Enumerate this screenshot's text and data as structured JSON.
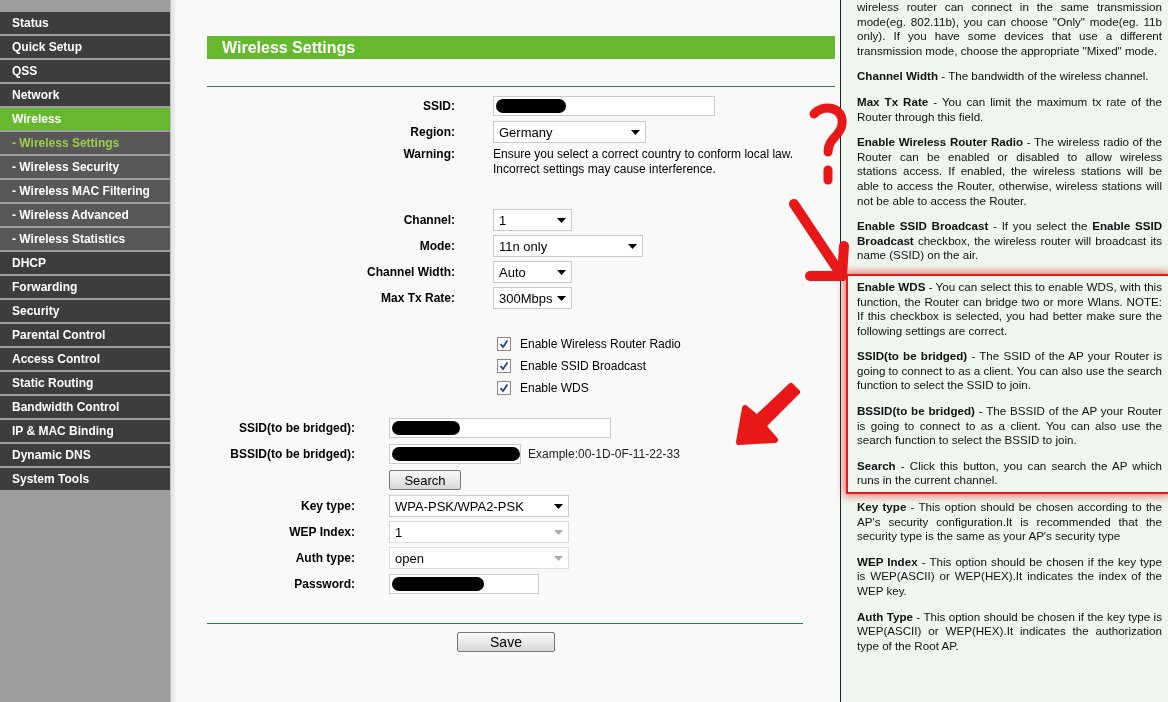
{
  "sidebar": {
    "items": [
      {
        "label": "Status",
        "expanded": false
      },
      {
        "label": "Quick Setup",
        "expanded": false
      },
      {
        "label": "QSS",
        "expanded": false
      },
      {
        "label": "Network",
        "expanded": false
      },
      {
        "label": "Wireless",
        "expanded": true,
        "children": [
          {
            "label": "- Wireless Settings",
            "selected": true
          },
          {
            "label": "- Wireless Security",
            "selected": false
          },
          {
            "label": "- Wireless MAC Filtering",
            "selected": false
          },
          {
            "label": "- Wireless Advanced",
            "selected": false
          },
          {
            "label": "- Wireless Statistics",
            "selected": false
          }
        ]
      },
      {
        "label": "DHCP",
        "expanded": false
      },
      {
        "label": "Forwarding",
        "expanded": false
      },
      {
        "label": "Security",
        "expanded": false
      },
      {
        "label": "Parental Control",
        "expanded": false
      },
      {
        "label": "Access Control",
        "expanded": false
      },
      {
        "label": "Static Routing",
        "expanded": false
      },
      {
        "label": "Bandwidth Control",
        "expanded": false
      },
      {
        "label": "IP & MAC Binding",
        "expanded": false
      },
      {
        "label": "Dynamic DNS",
        "expanded": false
      },
      {
        "label": "System Tools",
        "expanded": false
      }
    ]
  },
  "form": {
    "title": "Wireless Settings",
    "basic": [
      {
        "kind": "redacted-input",
        "label": "SSID:"
      },
      {
        "kind": "select",
        "label": "Region:",
        "value": "Germany",
        "disabled": false
      },
      {
        "kind": "note",
        "label": "Warning:",
        "lines": [
          "Ensure you select a correct country to conform local law.",
          "Incorrect settings may cause interference."
        ]
      }
    ],
    "radio": [
      {
        "kind": "select",
        "label": "Channel:",
        "value": "1",
        "disabled": false
      },
      {
        "kind": "select",
        "label": "Mode:",
        "value": "11n only",
        "disabled": false
      },
      {
        "kind": "select",
        "label": "Channel Width:",
        "value": "Auto",
        "disabled": false
      },
      {
        "kind": "select",
        "label": "Max Tx Rate:",
        "value": "300Mbps",
        "disabled": false
      }
    ],
    "options": [
      {
        "label": "Enable Wireless Router Radio",
        "checked": true
      },
      {
        "label": "Enable SSID Broadcast",
        "checked": true
      },
      {
        "label": "Enable WDS",
        "checked": true
      }
    ],
    "wds": [
      {
        "kind": "redacted-input",
        "label": "SSID(to be bridged):"
      },
      {
        "kind": "redacted-input",
        "label": "BSSID(to be bridged):",
        "hint": "Example:00-1D-0F-11-22-33"
      },
      {
        "kind": "button",
        "text": "Search"
      },
      {
        "kind": "select",
        "label": "Key type:",
        "value": "WPA-PSK/WPA2-PSK",
        "disabled": false
      },
      {
        "kind": "select",
        "label": "WEP Index:",
        "value": "1",
        "disabled": true
      },
      {
        "kind": "select",
        "label": "Auth type:",
        "value": "open",
        "disabled": true
      },
      {
        "kind": "redacted-input",
        "label": "Password:"
      }
    ],
    "save": "Save"
  },
  "help": {
    "paragraphs": [
      {
        "text": "wireless router can connect in the same transmission mode(eg. 802.11b), you can choose \"Only\" mode(eg. 11b only). If you have some devices that use a different transmission mode, choose the appropriate \"Mixed\" mode.",
        "highlighted": false
      },
      {
        "text": "**Channel Width** - The bandwidth of the wireless channel.",
        "highlighted": false
      },
      {
        "text": "**Max Tx Rate** - You can limit the maximum tx rate of the Router through this field.",
        "highlighted": false
      },
      {
        "text": "**Enable Wireless Router Radio** - The wireless radio of the Router can be enabled or disabled to allow wireless stations access. If enabled, the wireless stations will be able to access the Router, otherwise, wireless stations will not be able to access the Router.",
        "highlighted": false
      },
      {
        "text": "**Enable SSID Broadcast** - If you select the **Enable SSID Broadcast** checkbox, the wireless router will broadcast its name (SSID) on the air.",
        "highlighted": false
      },
      {
        "text": "**Enable WDS** - You can select this to enable WDS, with this function, the Router can bridge two or more Wlans. NOTE: If this checkbox is selected, you had better make sure the following settings are correct.",
        "highlighted": true
      },
      {
        "text": "**SSID(to be bridged)** - The SSID of the AP your Router is going to connect to as a client. You can also use the search function to select the SSID to join.",
        "highlighted": true
      },
      {
        "text": "**BSSID(to be bridged)** - The BSSID of the AP your Router is going to connect to as a client. You can also use the search function to select the BSSID to join.",
        "highlighted": true
      },
      {
        "text": "**Search** - Click this button, you can search the AP which runs in the current channel.",
        "highlighted": true
      },
      {
        "text": "**Key type** - This option should be chosen according to the AP's security configuration.It is recommended that the security type is the same as your AP's security type",
        "highlighted": false
      },
      {
        "text": "**WEP Index** - This option should be chosen if the key type is WEP(ASCII) or WEP(HEX).It indicates the index of the WEP key.",
        "highlighted": false
      },
      {
        "text": "**Auth Type** - This option should be chosen if the key type is WEP(ASCII) or WEP(HEX).It indicates the authorization type of the Root AP.",
        "highlighted": false
      }
    ]
  },
  "annotations": [
    {
      "kind": "question-mark"
    },
    {
      "kind": "arrow-down-right"
    },
    {
      "kind": "arrow-down-left"
    }
  ]
}
